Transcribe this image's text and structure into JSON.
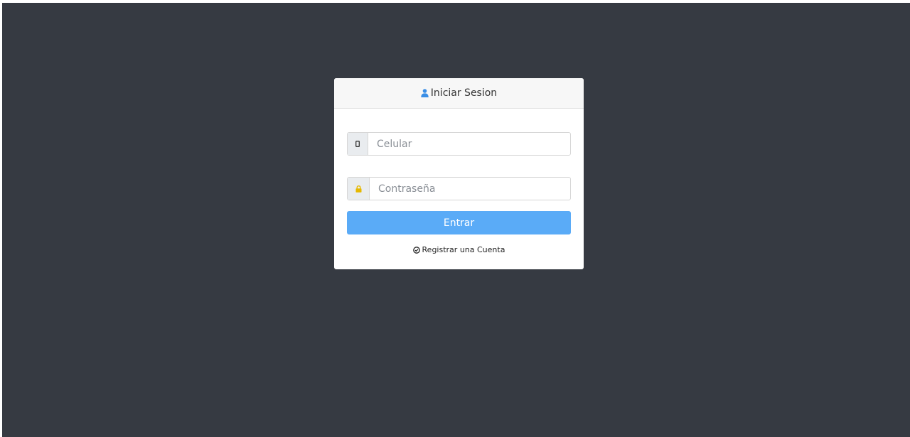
{
  "login": {
    "title": "Iniciar Sesion",
    "title_icon": "user-icon",
    "phone": {
      "icon": "mobile-phone-icon",
      "placeholder": "Celular",
      "value": ""
    },
    "password": {
      "icon": "lock-icon",
      "placeholder": "Contraseña",
      "value": ""
    },
    "submit_label": "Entrar",
    "register_icon": "check-circle-icon",
    "register_label": "Registrar una Cuenta"
  },
  "colors": {
    "background": "#363a42",
    "button": "#5aabf7",
    "user_icon": "#3a8ee6",
    "lock_icon": "#e6b800"
  }
}
